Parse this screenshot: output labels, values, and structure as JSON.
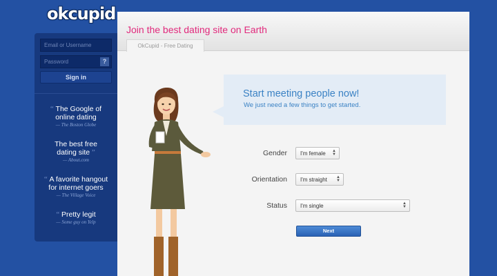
{
  "brand": {
    "logo": "okcupid"
  },
  "login": {
    "email_placeholder": "Email or Username",
    "password_placeholder": "Password",
    "help_label": "?",
    "signin_label": "Sign in"
  },
  "quotes": [
    {
      "text": "The Google of online dating",
      "source": "— The Boston Globe"
    },
    {
      "text": "The best free dating site",
      "source": "— About.com"
    },
    {
      "text": "A favorite hangout for internet goers",
      "source": "— The Village Voice"
    },
    {
      "text": "Pretty legit",
      "source": "— Some guy on Yelp"
    }
  ],
  "main": {
    "headline": "Join the best dating site on Earth",
    "tab_label": "OkCupid - Free Dating",
    "bubble_title": "Start meeting people now!",
    "bubble_subtitle": "We just need a few things to get started."
  },
  "form": {
    "gender_label": "Gender",
    "gender_value": "I'm female",
    "orientation_label": "Orientation",
    "orientation_value": "I'm straight",
    "status_label": "Status",
    "status_value": "I'm single",
    "next_label": "Next"
  },
  "colors": {
    "background": "#2351a3",
    "sidebar": "#17397e",
    "headline": "#e1297c",
    "accent": "#3b82c4"
  }
}
